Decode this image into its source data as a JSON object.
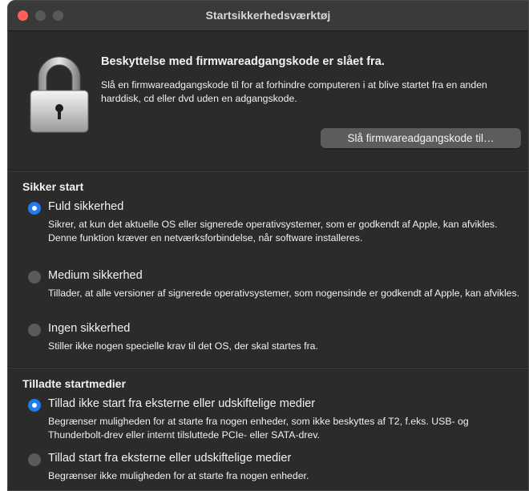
{
  "window": {
    "title": "Startsikkerhedsværktøj"
  },
  "firmware": {
    "heading": "Beskyttelse med firmwareadgangskode er slået fra.",
    "description": "Slå en firmwareadgangskode til for at forhindre computeren i at blive startet fra en anden harddisk, cd eller dvd uden en adgangskode.",
    "button": "Slå firmwareadgangskode til…"
  },
  "secure_boot": {
    "title": "Sikker start",
    "options": [
      {
        "label": "Fuld sikkerhed",
        "selected": true,
        "description": "Sikrer, at kun det aktuelle OS eller signerede operativsystemer, som er godkendt af Apple, kan afvikles. Denne funktion kræver en netværksforbindelse, når software installeres."
      },
      {
        "label": "Medium sikkerhed",
        "selected": false,
        "description": "Tillader, at alle versioner af signerede operativsystemer, som nogensinde er godkendt af Apple, kan afvikles."
      },
      {
        "label": "Ingen sikkerhed",
        "selected": false,
        "description": "Stiller ikke nogen specielle krav til det OS, der skal startes fra."
      }
    ]
  },
  "boot_media": {
    "title": "Tilladte startmedier",
    "options": [
      {
        "label": "Tillad ikke start fra eksterne eller udskiftelige medier",
        "selected": true,
        "description": "Begrænser muligheden for at starte fra nogen enheder, som ikke beskyttes af T2, f.eks. USB- og Thunderbolt-drev eller internt tilsluttede PCIe- eller SATA-drev."
      },
      {
        "label": "Tillad start fra eksterne eller udskiftelige medier",
        "selected": false,
        "description": "Begrænser ikke muligheden for at starte fra nogen enheder."
      }
    ]
  },
  "colors": {
    "accent": "#1d7df0",
    "background": "#2b2b2b"
  }
}
